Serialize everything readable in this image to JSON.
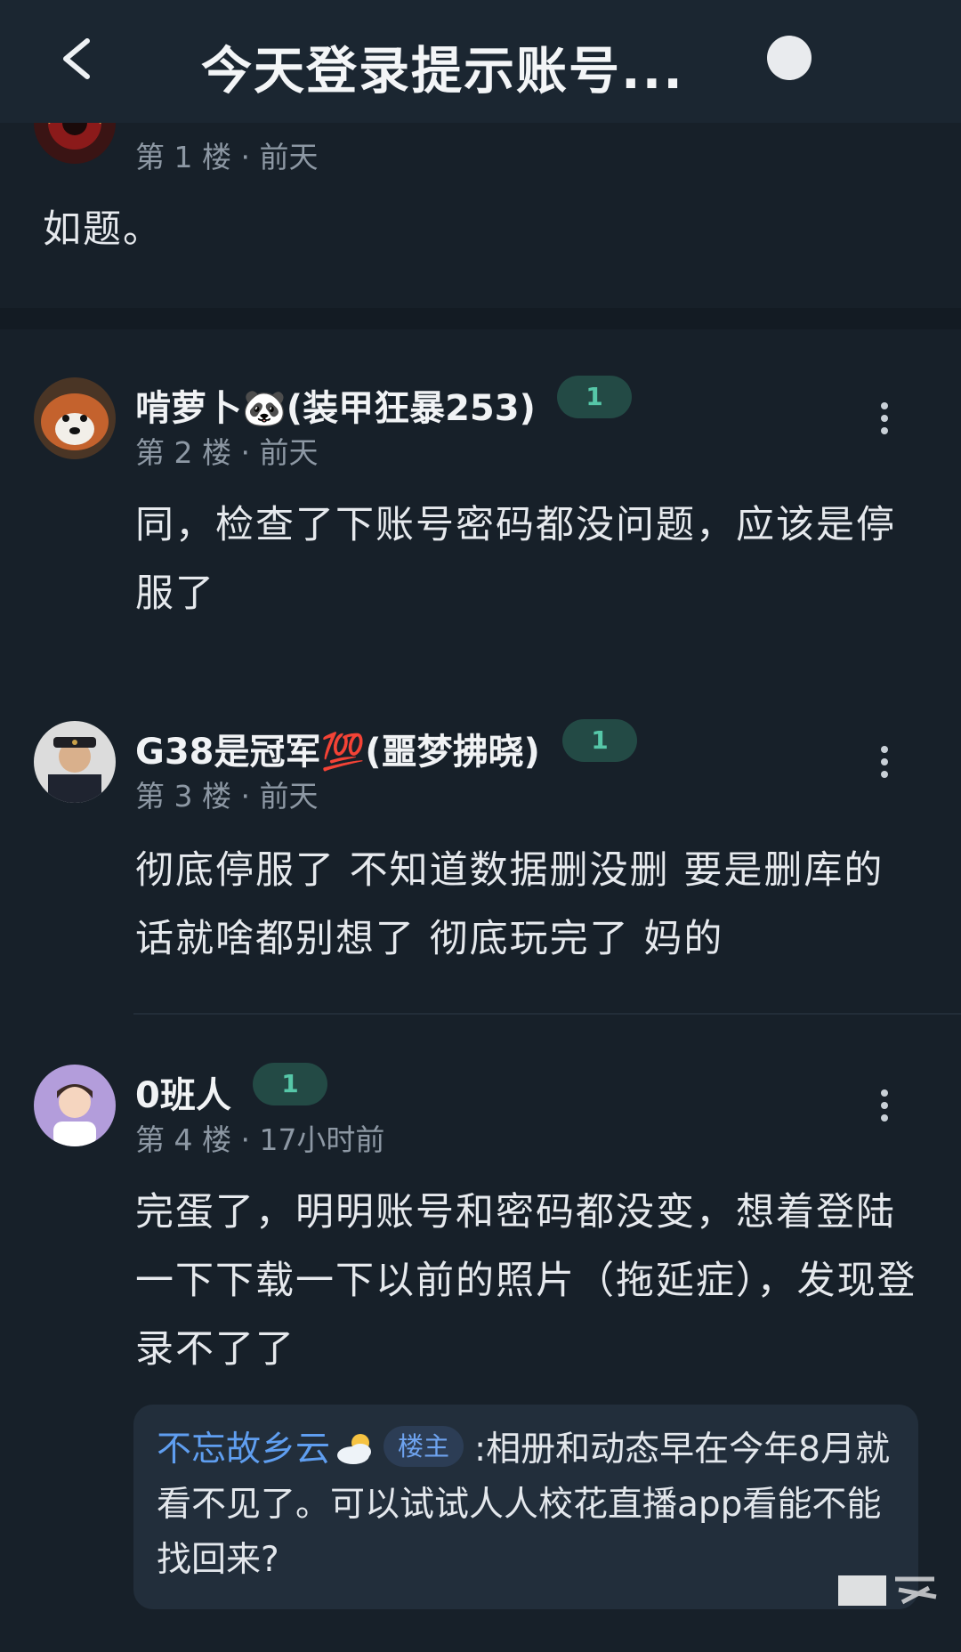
{
  "header": {
    "title": "今天登录提示账号...",
    "back_icon": "back-arrow-icon",
    "right_icon": "user-avatar-icon"
  },
  "posts": [
    {
      "floor": "第 1 楼 · 前天",
      "content": "如题。"
    },
    {
      "username": "啃萝卜🐼(装甲狂暴253)",
      "badge": "1",
      "floor": "第 2 楼 · 前天",
      "content": "同，检查了下账号密码都没问题，应该是停服了"
    },
    {
      "username": "G38是冠军💯(噩梦拂晓)",
      "badge": "1",
      "floor": "第 3 楼 · 前天",
      "content": "彻底停服了 不知道数据删没删 要是删库的话就啥都别想了 彻底玩完了 妈的"
    },
    {
      "username": "0班人",
      "badge": "1",
      "floor": "第 4 楼 · 17小时前",
      "content": "完蛋了，明明账号和密码都没变，想着登陆一下下载一下以前的照片（拖延症），发现登录不了了",
      "reply": {
        "user": "不忘故乡云",
        "tag": "楼主",
        "text": ":相册和动态早在今年8月就看不见了。可以试试人人校花直播app看能不能找回来?"
      }
    }
  ],
  "colors": {
    "background": "#172029",
    "badge_bg": "#234a45",
    "badge_text": "#56c7a8",
    "reply_user": "#5f9ef0"
  }
}
